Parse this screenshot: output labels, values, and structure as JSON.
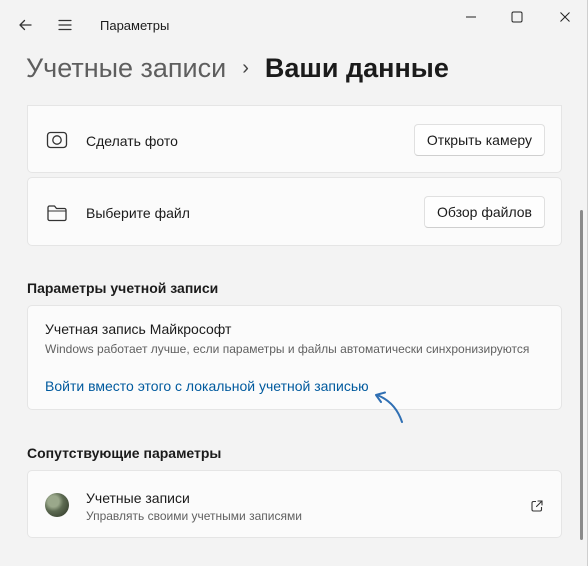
{
  "window": {
    "title": "Параметры",
    "back_icon": "back-arrow-icon",
    "menu_icon": "hamburger-menu-icon",
    "minimize_icon": "minimize-icon",
    "maximize_icon": "maximize-icon",
    "close_icon": "close-icon"
  },
  "breadcrumb": {
    "parent": "Учетные записи",
    "separator": "›",
    "current": "Ваши данные"
  },
  "photo_rows": [
    {
      "icon": "camera-icon",
      "label": "Сделать фото",
      "button": "Открыть камеру"
    },
    {
      "icon": "folder-icon",
      "label": "Выберите файл",
      "button": "Обзор файлов"
    }
  ],
  "account_settings": {
    "heading": "Параметры учетной записи",
    "title": "Учетная запись Майкрософт",
    "description": "Windows работает лучше, если параметры и файлы автоматически синхронизируются",
    "link": "Войти вместо этого с локальной учетной записью"
  },
  "related": {
    "heading": "Сопутствующие параметры",
    "items": [
      {
        "icon": "user-avatar",
        "title": "Учетные записи",
        "subtitle": "Управлять своими учетными записями",
        "action_icon": "external-link-icon"
      }
    ]
  },
  "colors": {
    "background": "#f3f3f3",
    "card": "#fbfbfb",
    "link": "#005a9e",
    "annotation_arrow": "#2f6fb3"
  }
}
